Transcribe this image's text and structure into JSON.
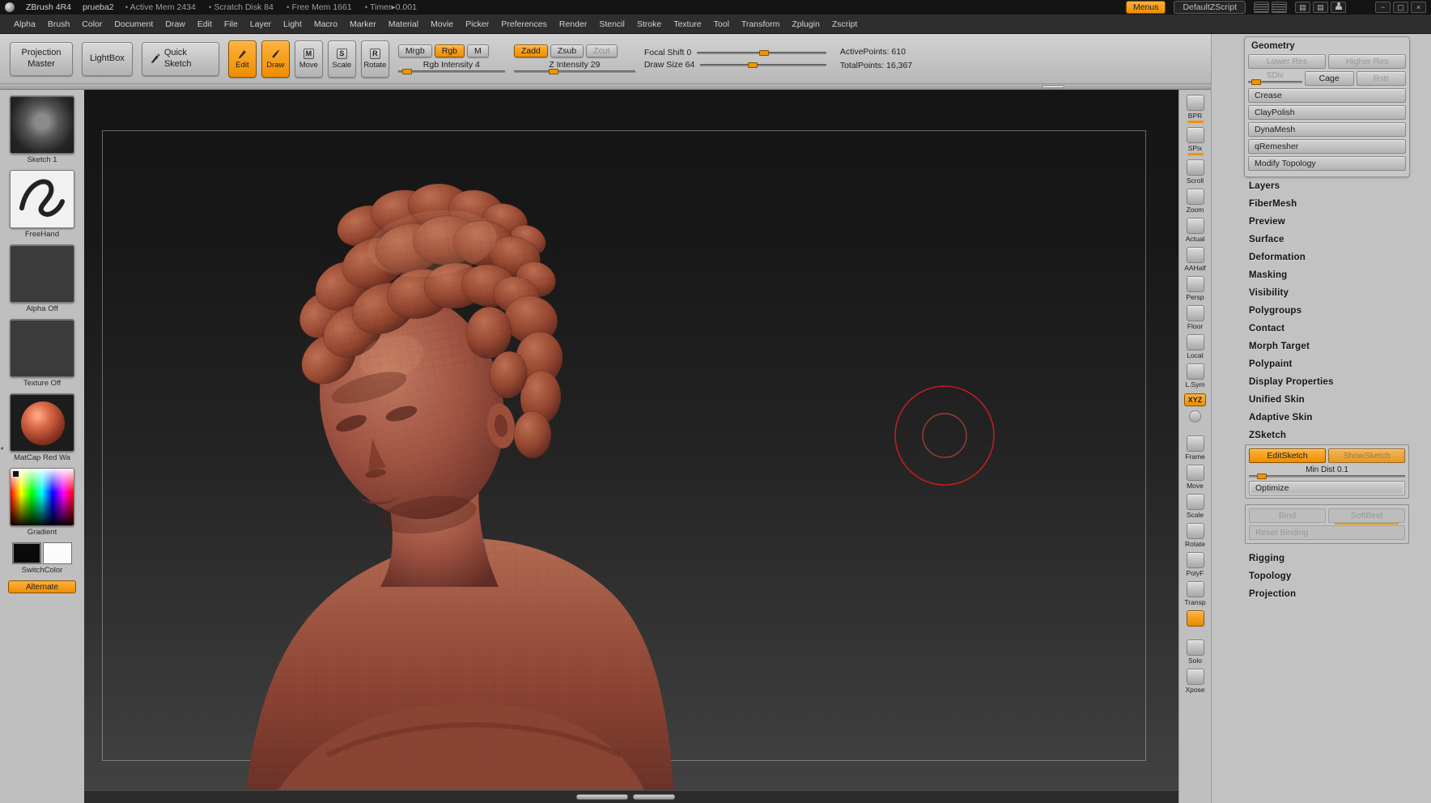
{
  "colors": {
    "accent": "#f29400",
    "clay": "#a2543f",
    "canvas_top": "#151515",
    "canvas_bottom": "#424242",
    "cursor_red": "#cf1f1f"
  },
  "titlebar": {
    "app_title": "ZBrush 4R4",
    "doc_name": "prueba2",
    "stats": [
      "Active Mem 2434",
      "Scratch Disk 84",
      "Free Mem 1661",
      "Timer▸0.001"
    ],
    "menus_button": "Menus",
    "zscript_button": "DefaultZScript",
    "icons": {
      "doc": "▤",
      "min": "−",
      "max": "▢",
      "close": "×"
    }
  },
  "menubar": {
    "items": [
      "Alpha",
      "Brush",
      "Color",
      "Document",
      "Draw",
      "Edit",
      "File",
      "Layer",
      "Light",
      "Macro",
      "Marker",
      "Material",
      "Movie",
      "Picker",
      "Preferences",
      "Render",
      "Stencil",
      "Stroke",
      "Texture",
      "Tool",
      "Transform",
      "Zplugin",
      "Zscript"
    ]
  },
  "shelf": {
    "projection_master": "Projection Master",
    "lightbox": "LightBox",
    "quick_sketch": "Quick Sketch",
    "modes": [
      {
        "label": "Edit",
        "icon": "pencil"
      },
      {
        "label": "Draw",
        "icon": "brush"
      },
      {
        "label": "Move",
        "icon": "M"
      },
      {
        "label": "Scale",
        "icon": "S"
      },
      {
        "label": "Rotate",
        "icon": "R"
      }
    ],
    "mrgb": "Mrgb",
    "rgb": "Rgb",
    "m": "M",
    "rgb_intensity": "Rgb Intensity 4",
    "zadd": "Zadd",
    "zsub": "Zsub",
    "zcut": "Zcut",
    "z_intensity": "Z Intensity 29",
    "focal_shift": "Focal Shift 0",
    "draw_size": "Draw Size 64",
    "active_points": "ActivePoints: 610",
    "total_points": "TotalPoints: 16,367"
  },
  "left_tray": {
    "sketch": "Sketch 1",
    "stroke": "FreeHand",
    "alpha": "Alpha Off",
    "texture": "Texture Off",
    "material": "MatCap Red Wa",
    "gradient": "Gradient",
    "switch_color": "SwitchColor",
    "alternate": "Alternate"
  },
  "right_toolbar": {
    "items": [
      {
        "label": "BPR",
        "state": "slider"
      },
      {
        "label": "SPix",
        "state": "slider"
      },
      {
        "label": "Scroll",
        "state": ""
      },
      {
        "label": "Zoom",
        "state": ""
      },
      {
        "label": "Actual",
        "state": ""
      },
      {
        "label": "AAHalf",
        "state": ""
      },
      {
        "label": "Persp",
        "state": ""
      },
      {
        "label": "Floor",
        "state": ""
      },
      {
        "label": "Local",
        "state": ""
      },
      {
        "label": "L.Sym",
        "state": ""
      },
      {
        "label": "XYZ",
        "state": "xyz"
      },
      {
        "label": "",
        "state": "round"
      },
      {
        "label": "Frame",
        "state": ""
      },
      {
        "label": "Move",
        "state": ""
      },
      {
        "label": "Scale",
        "state": ""
      },
      {
        "label": "Rotate",
        "state": ""
      },
      {
        "label": "PolyF",
        "state": ""
      },
      {
        "label": "Transp",
        "state": ""
      },
      {
        "label": "",
        "state": "accent"
      },
      {
        "label": "Solo",
        "state": ""
      },
      {
        "label": "Xpose",
        "state": ""
      }
    ]
  },
  "tool_panel": {
    "geometry": {
      "title": "Geometry",
      "lower_res": "Lower Res",
      "higher_res": "Higher Res",
      "sdiv": "SDiv",
      "cage": "Cage",
      "rstr": "Rstr",
      "buttons": [
        "Crease",
        "ClayPolish",
        "DynaMesh",
        "qRemesher",
        "Modify Topology"
      ]
    },
    "sections": [
      "Layers",
      "FiberMesh",
      "Preview",
      "Surface",
      "Deformation",
      "Masking",
      "Visibility",
      "Polygroups",
      "Contact",
      "Morph Target",
      "Polypaint",
      "Display Properties",
      "Unified Skin",
      "Adaptive Skin"
    ],
    "zsketch": {
      "title": "ZSketch",
      "edit_sketch": "EditSketch",
      "show_sketch": "ShowSketch",
      "min_dist": "Min Dist 0.1",
      "optimize": "Optimize",
      "bind": "Bind",
      "soft_bind": "SoftBind",
      "reset_binding": "Reset Binding"
    },
    "sections_bottom": [
      "Rigging",
      "Topology",
      "Projection"
    ]
  }
}
